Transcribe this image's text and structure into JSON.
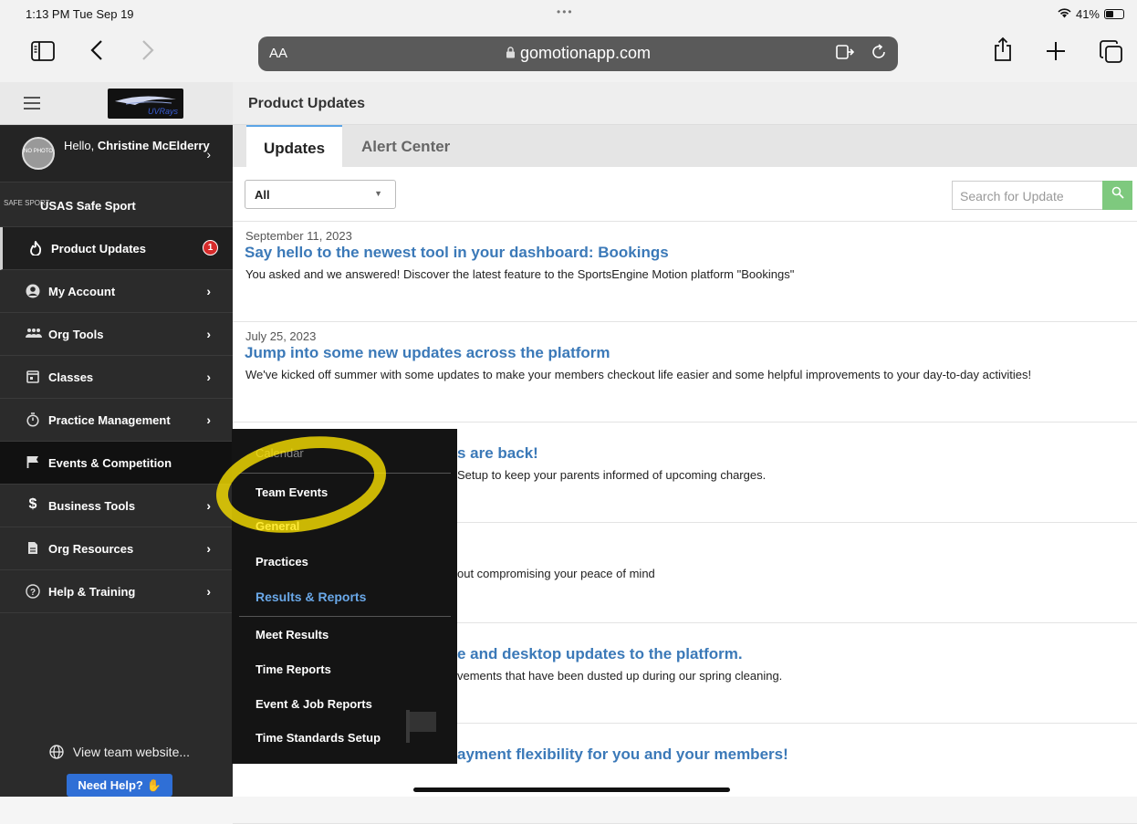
{
  "status_bar": {
    "time": "1:13 PM  Tue Sep 19",
    "dots": "•••",
    "battery": "41%"
  },
  "browser": {
    "text_size": "AA",
    "url": "gomotionapp.com"
  },
  "sidebar": {
    "logo_text": "UVRays",
    "user_greeting": "Hello, ",
    "user_name": "Christine McElderry",
    "avatar_text": "NO PHOTO",
    "safe_sport_mini": "SAFE SPORT",
    "safe_sport": "USAS Safe Sport",
    "items": [
      {
        "label": "Product Updates",
        "badge": "1"
      },
      {
        "label": "My Account"
      },
      {
        "label": "Org Tools"
      },
      {
        "label": "Classes"
      },
      {
        "label": "Practice Management"
      },
      {
        "label": "Events & Competition"
      },
      {
        "label": "Business Tools"
      },
      {
        "label": "Org Resources"
      },
      {
        "label": "Help & Training"
      }
    ],
    "view_site": "View team website...",
    "need_help": "Need Help?"
  },
  "content": {
    "title": "Product Updates",
    "tabs": [
      "Updates",
      "Alert Center"
    ],
    "filter_value": "All",
    "search_placeholder": "Search for Update",
    "updates": [
      {
        "date": "September 11, 2023",
        "title": "Say hello to the newest tool in your dashboard: Bookings",
        "desc": "You asked and we answered! Discover the latest feature to the SportsEngine Motion platform \"Bookings\""
      },
      {
        "date": "July 25, 2023",
        "title": "Jump into some new updates across the platform",
        "desc": "We've kicked off summer with some updates to make your members checkout life easier and some helpful improvements to your day-to-day activities!"
      },
      {
        "date": "",
        "title": "s are back!",
        "desc": "Setup to keep your parents informed of upcoming charges."
      },
      {
        "date": "",
        "title": "",
        "desc": "out compromising your peace of mind"
      },
      {
        "date": "",
        "title": "e and desktop updates to the platform.",
        "desc": "vements that have been dusted up during our spring cleaning."
      },
      {
        "date": "",
        "title": "ayment flexibility for you and your members!",
        "desc": ""
      }
    ]
  },
  "flyout": {
    "items": [
      "Calendar",
      "Team Events",
      "General",
      "Practices",
      "Results & Reports",
      "Meet Results",
      "Time Reports",
      "Event & Job Reports",
      "Time Standards Setup"
    ]
  },
  "colors": {
    "accent": "#3b79b8",
    "sidebar": "#2b2b2b",
    "highlight": "#ffe600",
    "search_button": "#7ec97e",
    "badge": "#d62b2b"
  }
}
